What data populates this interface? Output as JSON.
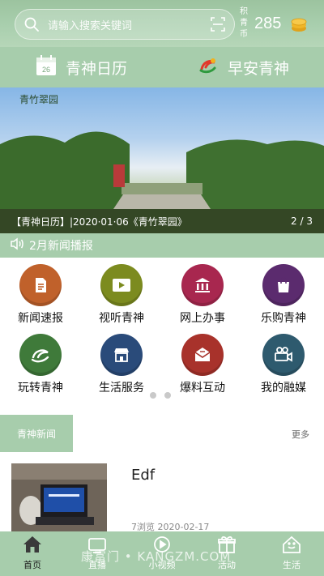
{
  "header": {
    "search_placeholder": "请输入搜索关键词",
    "points_label": "积青币",
    "points_value": "285"
  },
  "quick": {
    "calendar_day": "26",
    "calendar_label": "青神日历",
    "morning_label": "早安青神"
  },
  "banner": {
    "corner_text": "青竹翠园",
    "caption": "【青神日历】|2020·01·06《青竹翠园》",
    "page": "2 / 3"
  },
  "broadcast": {
    "label": "2月新闻播报"
  },
  "grid": {
    "items": [
      {
        "label": "新闻速报",
        "color": "#c0612b"
      },
      {
        "label": "视听青神",
        "color": "#7c8b1f"
      },
      {
        "label": "网上办事",
        "color": "#a8274f"
      },
      {
        "label": "乐购青神",
        "color": "#5b2b6e"
      },
      {
        "label": "玩转青神",
        "color": "#3f7a3a"
      },
      {
        "label": "生活服务",
        "color": "#2a4b7a"
      },
      {
        "label": "爆料互动",
        "color": "#a8322b"
      },
      {
        "label": "我的融媒",
        "color": "#2e5a6e"
      }
    ]
  },
  "section": {
    "tab": "青神新闻",
    "more": "更多"
  },
  "news": [
    {
      "title": "Edf",
      "meta": "7浏览 2020-02-17"
    }
  ],
  "nav": {
    "items": [
      {
        "label": "首页"
      },
      {
        "label": "直播"
      },
      {
        "label": "小视频"
      },
      {
        "label": "活动"
      },
      {
        "label": "生活"
      }
    ]
  },
  "watermark": "康富门 • KANGZM.COM",
  "colors": {
    "accent": "#a7cdac",
    "header": "#9cc39f"
  }
}
